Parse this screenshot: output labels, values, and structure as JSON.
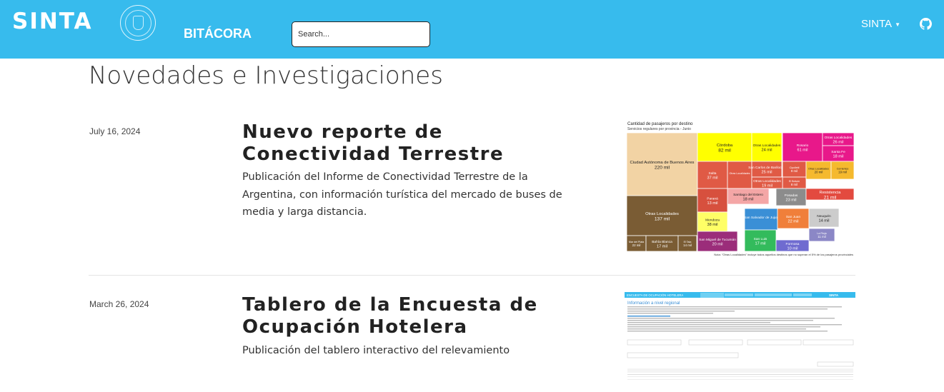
{
  "header": {
    "brand": "SINTA",
    "nav_link": "BITÁCORA",
    "search_placeholder": "Search...",
    "user_menu": "SINTA",
    "caret": "▼"
  },
  "page_title": "Novedades e Investigaciones",
  "posts": [
    {
      "date": "July 16, 2024",
      "title": "Nuevo reporte de Conectividad Terrestre",
      "description": "Publicación del Informe de Conectividad Terrestre de la Argentina, con información turística del mercado de buses de media y larga distancia.",
      "thumbnail": {
        "title": "Cantidad de pasajeros por destino",
        "subtitle": "Servicios regulares por provincia - Junio",
        "note": "Nota: \"Otras Localidades\" incluye todos aquellos destinos que no superan el 5% de los pasajeros provinciales",
        "cells": [
          {
            "label": "Ciudad Autónoma de Buenos Aires",
            "value": "220 mil",
            "color": "#f2d3a4"
          },
          {
            "label": "Otras Localidades",
            "value": "137 mil",
            "color": "#7a5c34"
          },
          {
            "label": "Mar del Plata",
            "value": "22 mil",
            "color": "#7a5c34"
          },
          {
            "label": "Bahía Blanca",
            "value": "17 mil",
            "color": "#7a5c34"
          },
          {
            "label": "El Tala",
            "value": "14 mil",
            "color": "#7a5c34"
          },
          {
            "label": "Córdoba",
            "value": "82 mil",
            "color": "#ffff00"
          },
          {
            "label": "Otras Localidades",
            "value": "24 mil",
            "color": "#ffff00"
          },
          {
            "label": "Rosario",
            "value": "61 mil",
            "color": "#e8188a"
          },
          {
            "label": "Otras Localidades",
            "value": "26 mil",
            "color": "#e8188a"
          },
          {
            "label": "Santa Fe",
            "value": "18 mil",
            "color": "#e8188a"
          },
          {
            "label": "Salta",
            "value": "37 mil",
            "color": "#e05a45"
          },
          {
            "label": "Otras Localidades",
            "value": "",
            "color": "#e05a45"
          },
          {
            "label": "San Carlos de Bariloche",
            "value": "25 mil",
            "color": "#e05a45"
          },
          {
            "label": "Cipolletti",
            "value": "9 mil",
            "color": "#e05a45"
          },
          {
            "label": "El Bolsón",
            "value": "8 mil",
            "color": "#e05a45"
          },
          {
            "label": "Otras Localidades",
            "value": "19 mil",
            "color": "#e05a45"
          },
          {
            "label": "Otras Localidades",
            "value": "20 mil",
            "color": "#f5b92e"
          },
          {
            "label": "Corrientes",
            "value": "19 mil",
            "color": "#f5b92e"
          },
          {
            "label": "Paraná",
            "value": "13 mil",
            "color": "#d7503e"
          },
          {
            "label": "Santiago del Estero",
            "value": "18 mil",
            "color": "#f4a6a6"
          },
          {
            "label": "Posadas",
            "value": "23 mil",
            "color": "#8c8c8c"
          },
          {
            "label": "Resistencia",
            "value": "21 mil",
            "color": "#e34a3f"
          },
          {
            "label": "Mendoza",
            "value": "38 mil",
            "color": "#ffff66"
          },
          {
            "label": "San Salvador de Jujuy",
            "value": "",
            "color": "#3a8fd6"
          },
          {
            "label": "San Juan",
            "value": "22 mil",
            "color": "#f07f3a"
          },
          {
            "label": "Neuquén",
            "value": "14 mil",
            "color": "#cccccc"
          },
          {
            "label": "San Luis",
            "value": "17 mil",
            "color": "#33bb5c"
          },
          {
            "label": "La Rioja",
            "value": "11 mil",
            "color": "#8b87c6"
          },
          {
            "label": "San Miguel de Tucumán",
            "value": "20 mil",
            "color": "#9b2d7a"
          },
          {
            "label": "Formosa",
            "value": "10 mil",
            "color": "#6f6bd0"
          }
        ]
      }
    },
    {
      "date": "March 26, 2024",
      "title": "Tablero de la Encuesta de Ocupación Hotelera",
      "description": "Publicación del tablero interactivo del relevamiento",
      "thumbnail": {
        "app_title": "ENCUESTA DE OCUPACIÓN HOTELERA",
        "section": "Información a nivel regional",
        "brand": "SINTA"
      }
    }
  ]
}
